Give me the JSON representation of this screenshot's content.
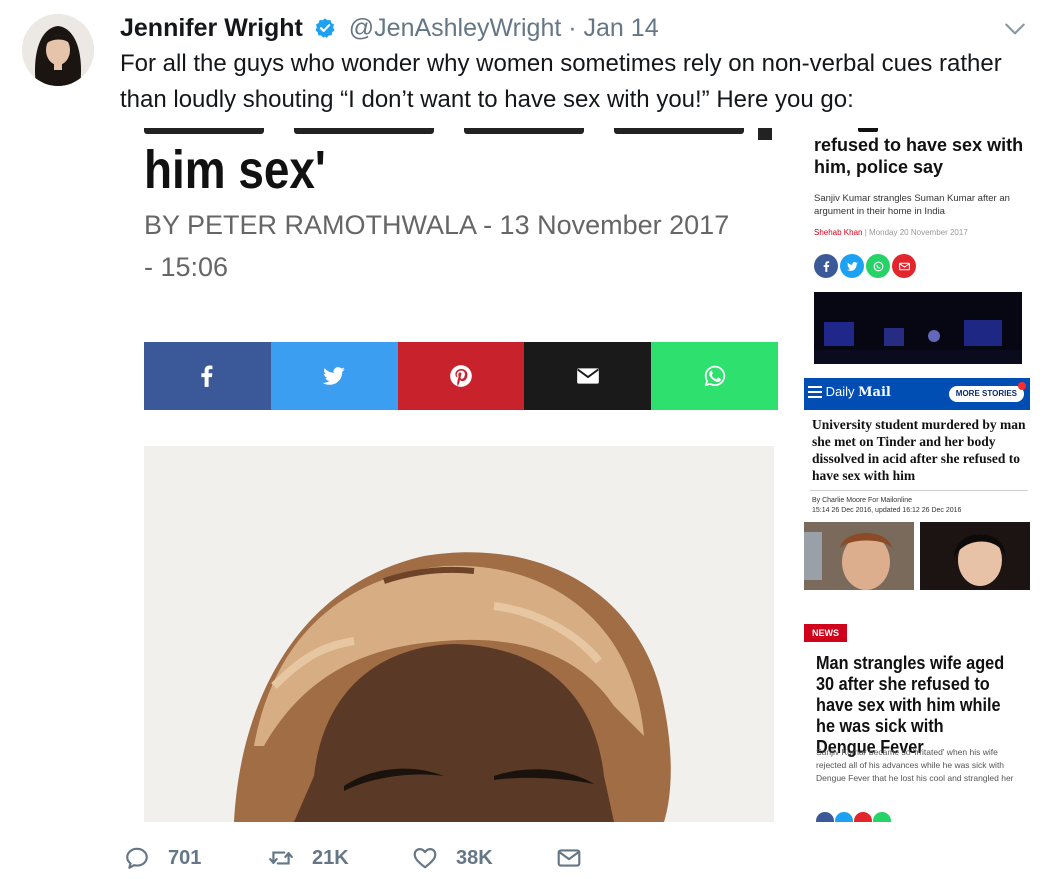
{
  "tweet": {
    "author_name": "Jennifer Wright",
    "handle": "@JenAshleyWright",
    "separator": "·",
    "date": "Jan 14",
    "text": "For all the guys who wonder why women sometimes rely on non-verbal cues rather than loudly shouting “I don’t want to have sex with you!” Here you go:"
  },
  "media": {
    "left_article": {
      "headline_fragment": "him sex'",
      "byline": "BY PETER RAMOTHWALA - 13 November 2017 - 15:06",
      "share_buttons": [
        {
          "icon": "facebook-icon",
          "color": "#3b5998"
        },
        {
          "icon": "twitter-icon",
          "color": "#3c9ef0"
        },
        {
          "icon": "pinterest-icon",
          "color": "#c8232c"
        },
        {
          "icon": "email-icon",
          "color": "#1a1a1a"
        },
        {
          "icon": "whatsapp-icon",
          "color": "#2ee06e"
        }
      ]
    },
    "indian_express": {
      "headline": "refused to have sex with him, police say",
      "summary": "Sanjiv Kumar strangles Suman Kumar after an argument in their home in India",
      "author": "Shehab Khan",
      "meta_separator": "|",
      "date": "Monday 20 November 2017"
    },
    "daily_mail": {
      "logo_prefix": "Daily",
      "logo_mail": "Mail",
      "more_stories": "MORE STORIES",
      "headline": "University student murdered by man she met on Tinder and her body dissolved in acid after she refused to have sex with him",
      "byline": "By Charlie Moore For Mailonline",
      "timestamp": "15:14 26 Dec 2016, updated 16:12 26 Dec 2016"
    },
    "news_article": {
      "badge": "NEWS",
      "headline": "Man strangles wife aged 30 after she refused to have sex with him while he was sick with Dengue Fever",
      "summary": "Sanjiv Kumar became so 'irritated' when his wife rejected all of his advances while he was sick with Dengue Fever that he lost his cool and strangled her"
    }
  },
  "actions": {
    "replies": "701",
    "retweets": "21K",
    "likes": "38K"
  },
  "colors": {
    "verified": "#1da1f2",
    "action_gray": "#657786",
    "daily_mail_blue": "#004db3",
    "news_red": "#d0021b"
  }
}
